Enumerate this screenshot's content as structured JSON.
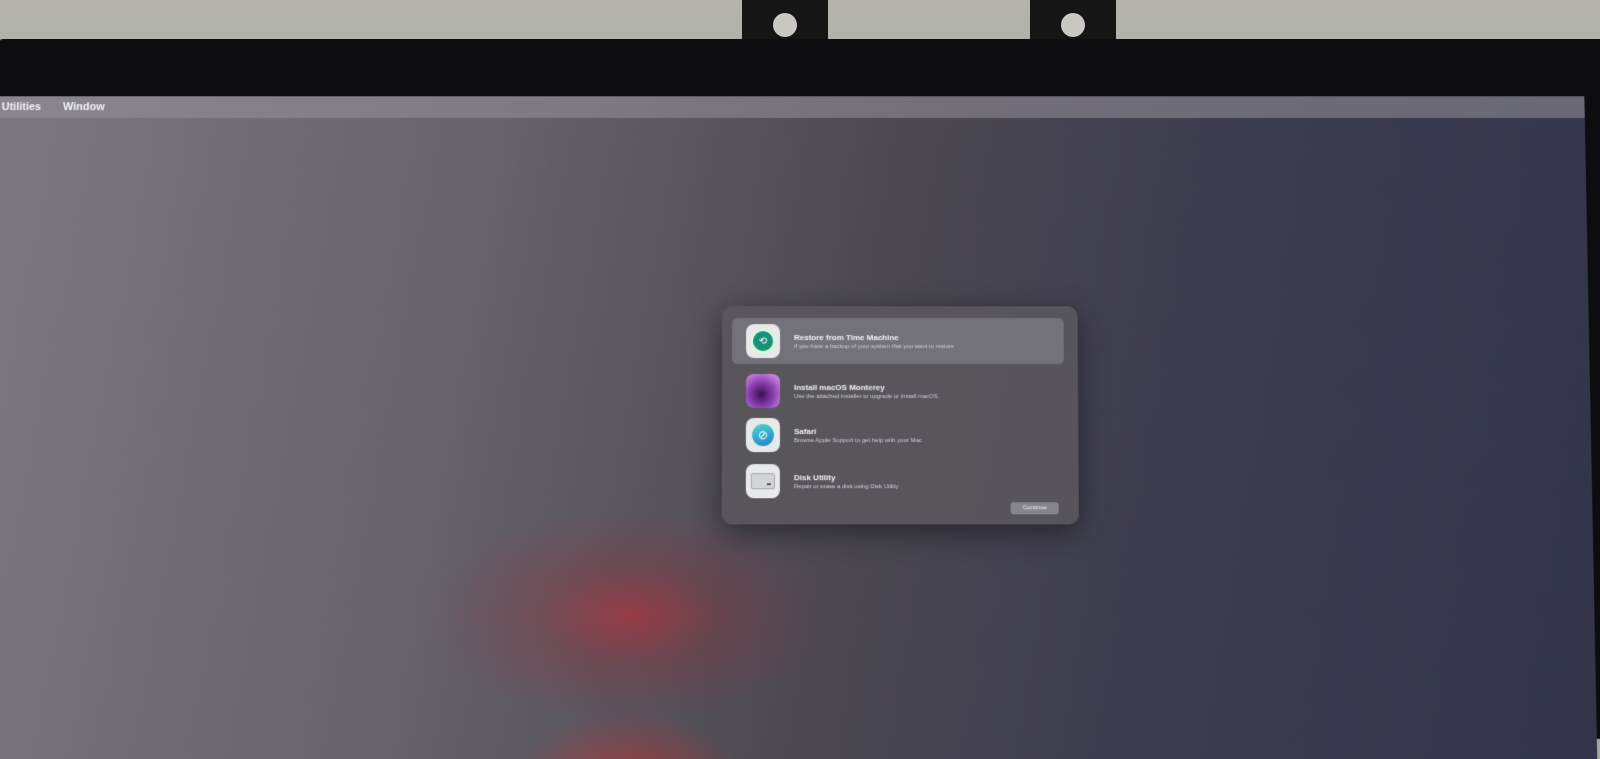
{
  "menubar": {
    "items": [
      "Utilities",
      "Window"
    ]
  },
  "recovery_dialog": {
    "options": [
      {
        "title": "Restore from Time Machine",
        "description": "If you have a backup of your system that you want to restore",
        "icon": "time-machine-icon",
        "selected": true
      },
      {
        "title": "Install macOS Monterey",
        "description": "Use the attached installer to upgrade or install macOS",
        "icon": "macos-installer-icon",
        "selected": false
      },
      {
        "title": "Safari",
        "description": "Browse Apple Support to get help with your Mac",
        "icon": "safari-icon",
        "selected": false
      },
      {
        "title": "Disk Utility",
        "description": "Repair or erase a disk using Disk Utility",
        "icon": "disk-utility-icon",
        "selected": false
      }
    ],
    "continue_label": "Continue"
  },
  "colors": {
    "dialog_background": "#58565c",
    "selected_row": "#78767c",
    "menubar": "#96919b"
  }
}
